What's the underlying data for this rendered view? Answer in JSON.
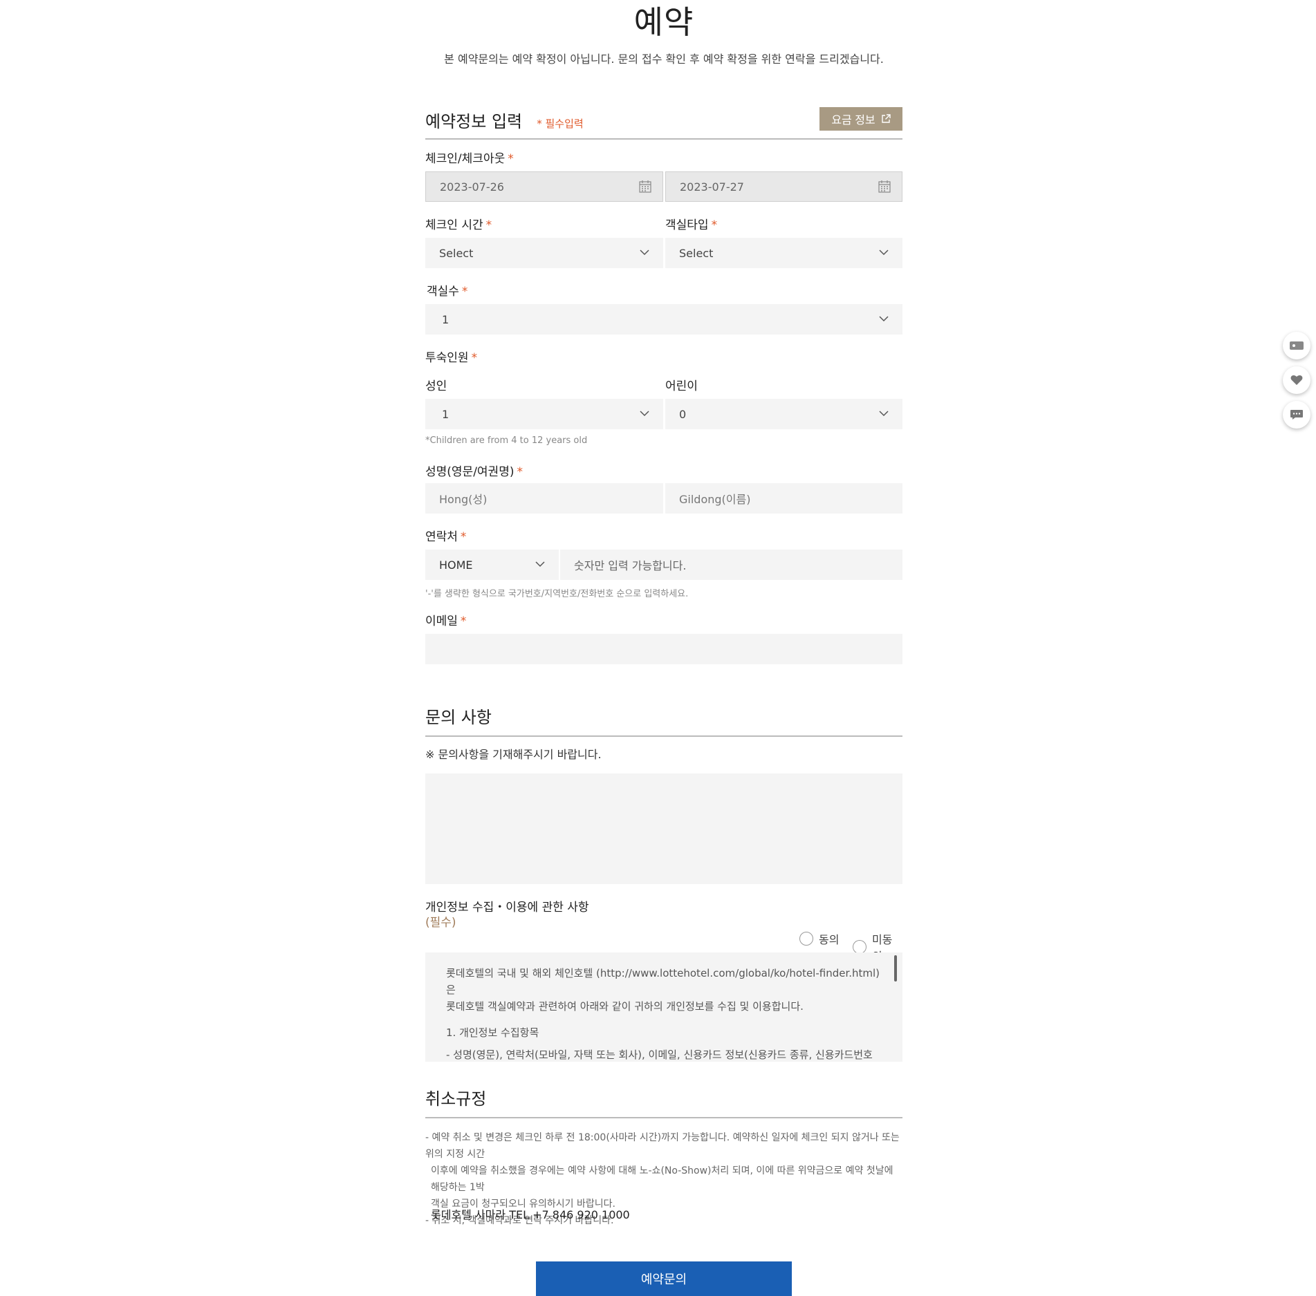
{
  "page": {
    "title": "예약",
    "subtitle": "본 예약문의는 예약 확정이 아닙니다. 문의 접수 확인 후 예약 확정을 위한 연락을 드리겠습니다."
  },
  "reservation": {
    "section_title": "예약정보 입력",
    "required_note": "* 필수입력",
    "rate_button": "요금 정보",
    "checkin_checkout_label": "체크인/체크아웃",
    "checkin_date": "2023-07-26",
    "checkout_date": "2023-07-27",
    "checkin_time_label": "체크인 시간",
    "checkin_time_value": "Select",
    "room_type_label": "객실타입",
    "room_type_value": "Select",
    "room_count_label": "객실수",
    "room_count_value": "1",
    "guests_label": "투숙인원",
    "adult_label": "성인",
    "adult_value": "1",
    "child_label": "어린이",
    "child_value": "0",
    "child_hint": "*Children are from 4 to 12 years old",
    "name_label": "성명(영문/여권명)",
    "last_name_placeholder": "Hong(성)",
    "first_name_placeholder": "Gildong(이름)",
    "contact_label": "연락처",
    "phone_type": "HOME",
    "phone_placeholder": "숫자만 입력 가능합니다.",
    "phone_hint": "'-'를 생략한 형식으로 국가번호/지역번호/전화번호 순으로 입력하세요.",
    "email_label": "이메일",
    "email_value": ""
  },
  "inquiry": {
    "section_title": "문의 사항",
    "note": "※ 문의사항을 기재해주시기 바랍니다."
  },
  "privacy": {
    "title": "개인정보 수집・이용에 관한 사항",
    "required": "(필수)",
    "agree": "동의",
    "disagree": "미동의",
    "lines": [
      "롯데호텔의 국내 및 해외 체인호텔 (http://www.lottehotel.com/global/ko/hotel-finder.html)은",
      "롯데호텔 객실예약과 관련하여 아래와 같이 귀하의 개인정보를 수집 및 이용합니다.",
      "",
      "1. 개인정보 수집항목",
      "- 성명(영문), 연락처(모바일, 자택 또는 회사), 이메일, 신용카드 정보(신용카드 종류, 신용카드번호 및"
    ]
  },
  "cancel": {
    "section_title": "취소규정",
    "lines": [
      "- 예약 취소 및 변경은 체크인 하루 전 18:00(사마라 시간)까지 가능합니다. 예약하신 일자에 체크인 되지 않거나 또는 위의 지정 시간",
      "  이후에 예약을 취소했을 경우에는 예약 사항에 대해 노-쇼(No-Show)처리 되며, 이에 따른 위약금으로 예약 첫날에 해당하는 1박",
      "  객실 요금이 청구되오니 유의하시기 바랍니다.",
      "- 취소 시, 객실예약과로 연락 주시기 바랍니다."
    ],
    "tel": "롯데호텔 사마라 TEL +7 846 920 1000"
  },
  "submit_label": "예약문의",
  "colors": {
    "accent": "#a89a83",
    "required": "#e05a2b",
    "submit": "#1a5fb4"
  },
  "floating": [
    "coupon-icon",
    "heart-icon",
    "chat-icon"
  ]
}
